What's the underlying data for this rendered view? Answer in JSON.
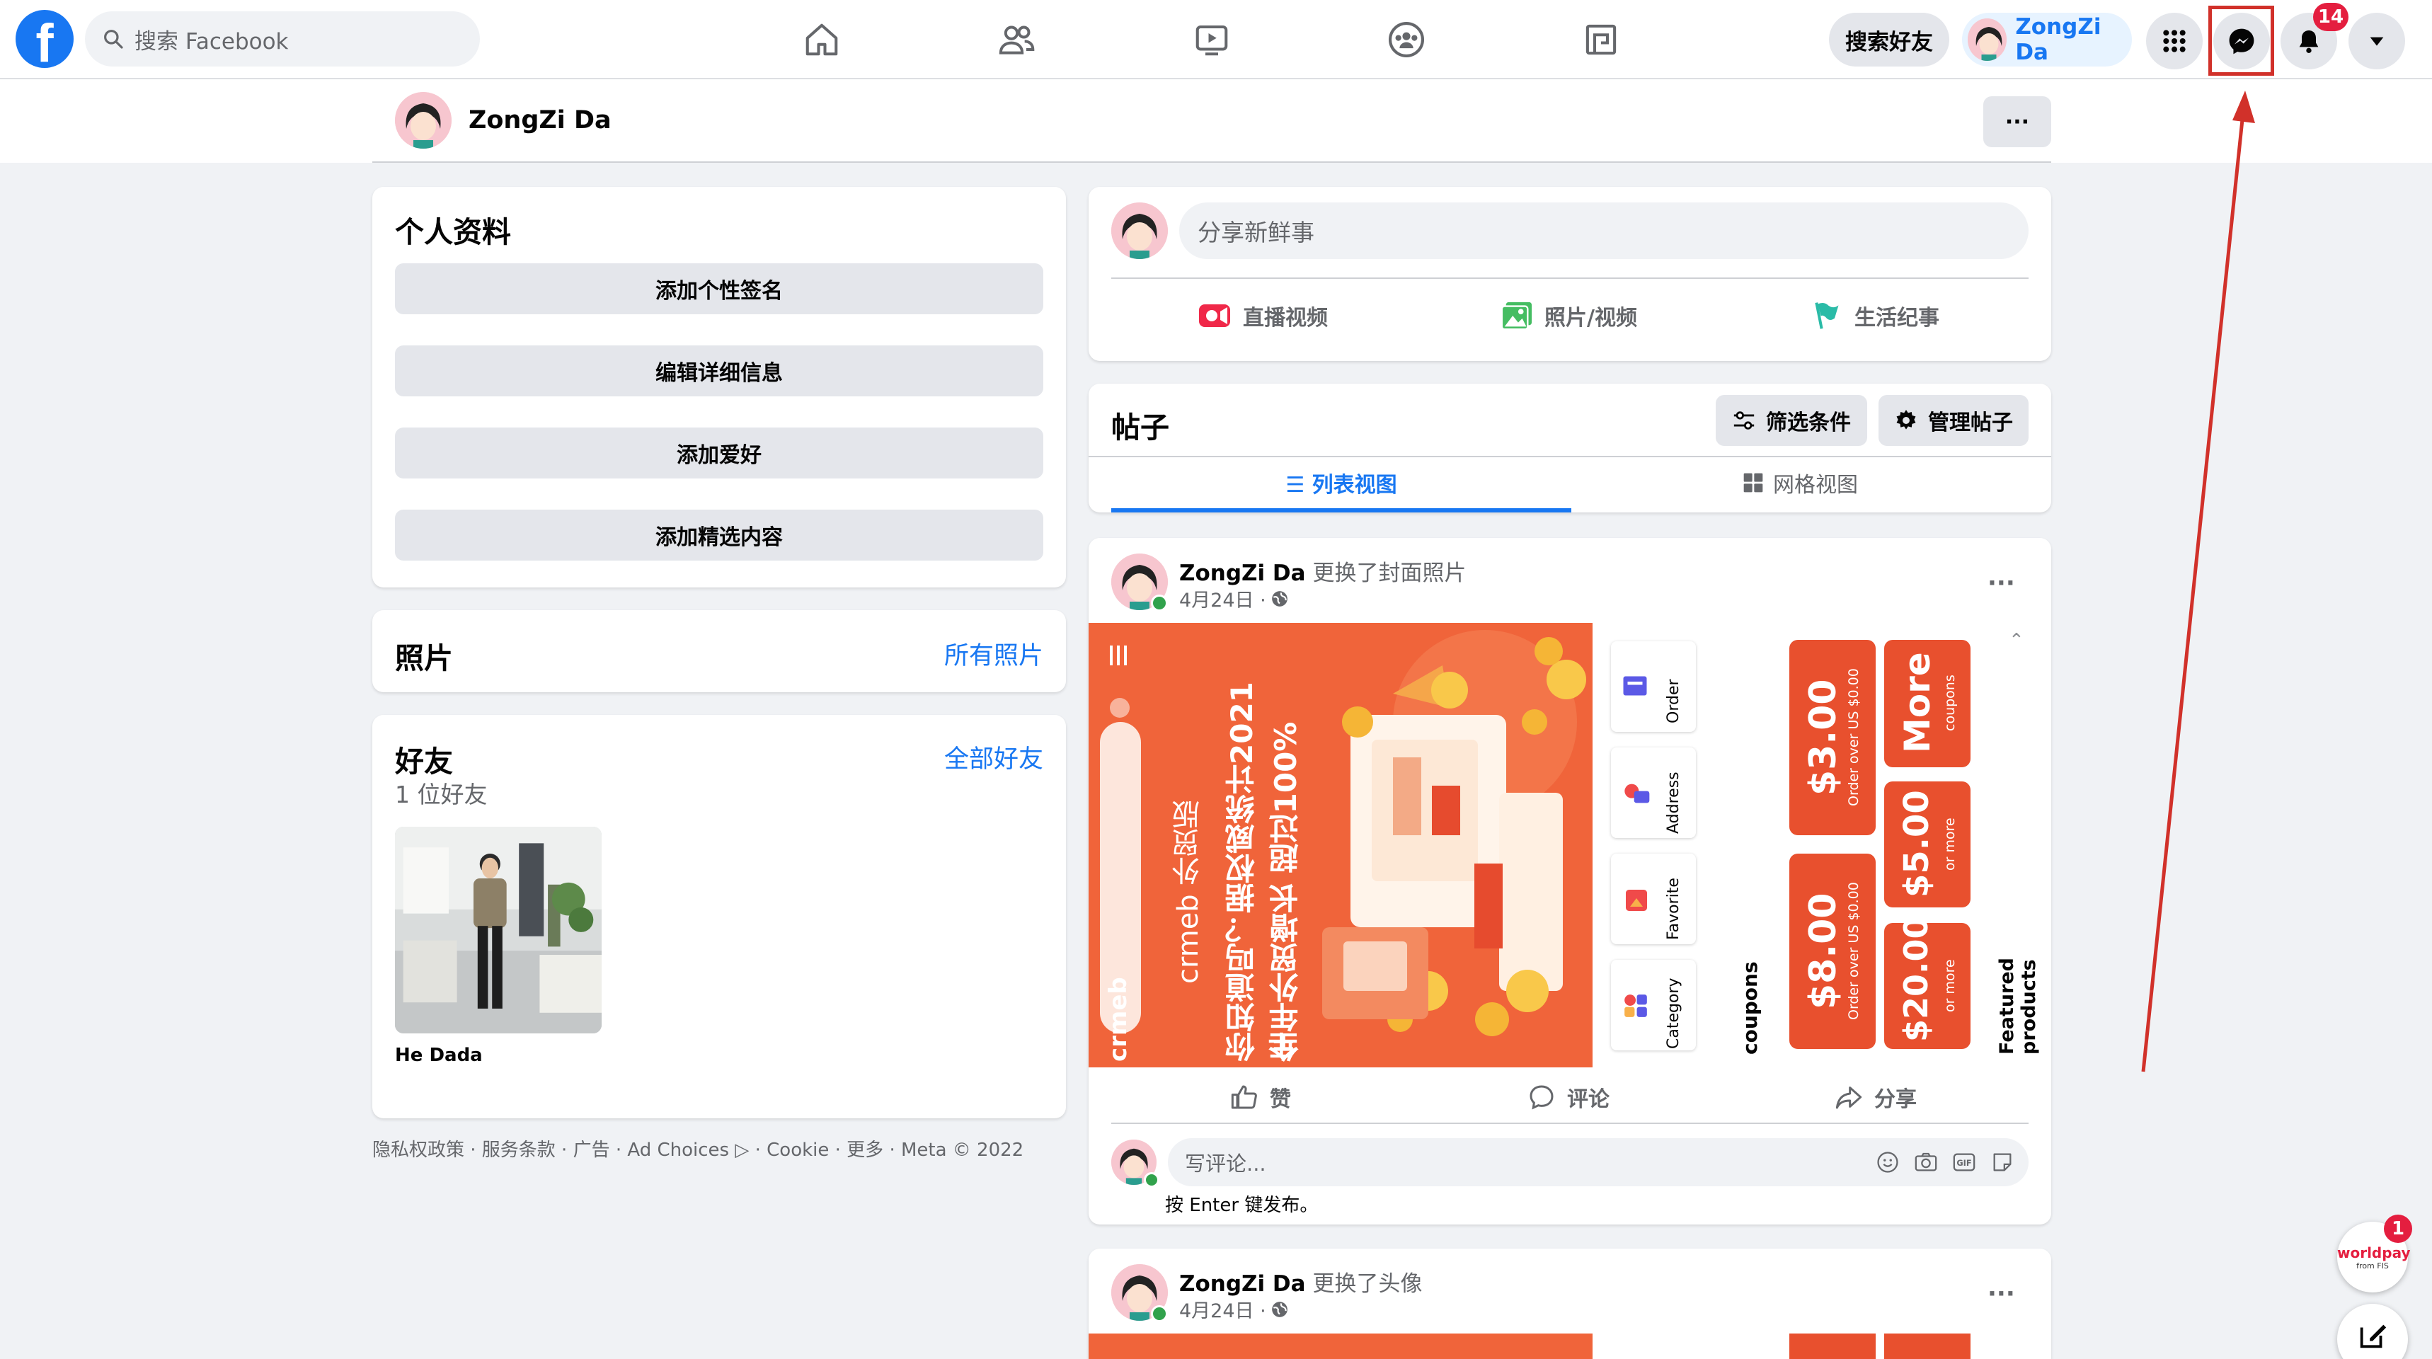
{
  "topbar": {
    "logo": "f",
    "search_placeholder": "搜索 Facebook",
    "nav_icons": [
      "home-icon",
      "friends-icon",
      "watch-icon",
      "groups-icon",
      "gaming-icon"
    ],
    "find_friends": "搜索好友",
    "profile_name": "ZongZi Da",
    "notification_count": "14"
  },
  "profile_header": {
    "name": "ZongZi Da",
    "more": "···"
  },
  "intro": {
    "title": "个人资料",
    "buttons": [
      "添加个性签名",
      "编辑详细信息",
      "添加爱好",
      "添加精选内容"
    ]
  },
  "photos": {
    "title": "照片",
    "link": "所有照片"
  },
  "friends": {
    "title": "好友",
    "link": "全部好友",
    "count": "1 位好友",
    "friend_name": "He Dada"
  },
  "footer": "隐私权政策 · 服务条款 · 广告 · Ad Choices ▷ · Cookie · 更多 · Meta © 2022",
  "composer": {
    "placeholder": "分享新鲜事",
    "live": "直播视频",
    "photo": "照片/视频",
    "life": "生活纪事"
  },
  "posts_header": {
    "title": "帖子",
    "filter": "筛选条件",
    "manage": "管理帖子",
    "list_view": "☰ 列表视图",
    "grid_view": "网格视图"
  },
  "post1": {
    "author": "ZongZi Da",
    "action": "更换了封面照片",
    "date": "4月24日 ·",
    "banner": {
      "brand": "crmeb",
      "brand_sub": "crmeb 外贸版",
      "headline": "你知道吗？据权威统计2021年",
      "headline2": "全年外贸增长 超过100%",
      "menu": [
        "Order",
        "Address",
        "Favorite",
        "Category"
      ],
      "coupons_label": "coupons",
      "coupon1": "$3.00",
      "coupon1_sub": "Order over US $0.00",
      "coupon2": "$8.00",
      "coupon2_sub": "Order over US $0.00",
      "more": "More",
      "more_sub": "coupons",
      "coupon3": "$5.00",
      "coupon3_sub": "or more",
      "coupon4": "$20.00",
      "coupon4_sub": "or more",
      "featured": "Featured products"
    },
    "like": "赞",
    "comment": "评论",
    "share": "分享",
    "comment_placeholder": "写评论...",
    "enter_hint": "按 Enter 键发布。"
  },
  "post2": {
    "author": "ZongZi Da",
    "action": "更换了头像",
    "date": "4月24日 ·"
  },
  "worldpay": {
    "label": "worldpay",
    "sub": "from FIS",
    "count": "1"
  },
  "colors": {
    "accent": "#1877f2",
    "banner_orange": "#f0643a",
    "annotation_red": "#d1312a"
  }
}
